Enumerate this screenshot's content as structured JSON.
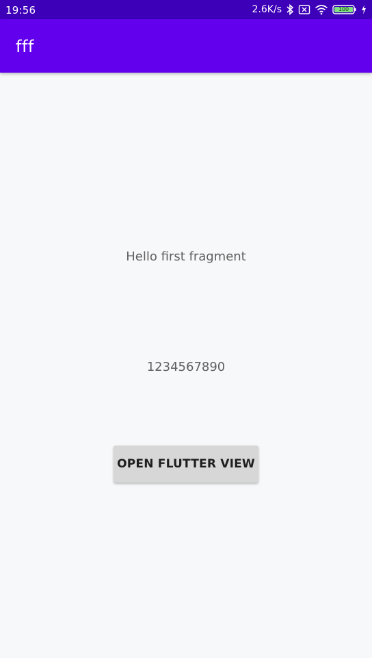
{
  "status_bar": {
    "time": "19:56",
    "net_speed": "2.6K/s",
    "battery_level": "100",
    "icons": [
      "bluetooth-icon",
      "sim-blocked-icon",
      "wifi-icon",
      "battery-icon",
      "charging-bolt-icon"
    ]
  },
  "app_bar": {
    "title": "fff",
    "color": "#6200ee"
  },
  "main": {
    "hello_text": "Hello first fragment",
    "number_text": "1234567890",
    "button_label": "OPEN FLUTTER VIEW"
  },
  "colors": {
    "status_bar": "#3d00b8",
    "background": "#f7f8f9",
    "button": "#d7d7d7"
  }
}
